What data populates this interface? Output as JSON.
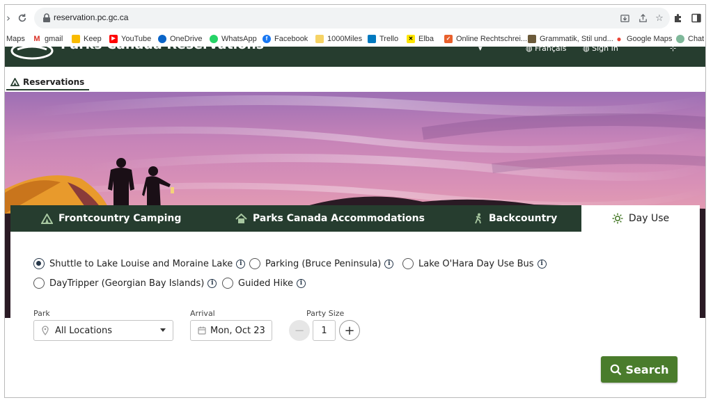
{
  "browser": {
    "url": "reservation.pc.gc.ca",
    "bookmarks": [
      {
        "label": "Maps",
        "icon": "maps-icon"
      },
      {
        "label": "gmail",
        "icon": "gmail-icon"
      },
      {
        "label": "Keep",
        "icon": "keep-icon"
      },
      {
        "label": "YouTube",
        "icon": "youtube-icon"
      },
      {
        "label": "OneDrive",
        "icon": "onedrive-icon"
      },
      {
        "label": "WhatsApp",
        "icon": "whatsapp-icon"
      },
      {
        "label": "Facebook",
        "icon": "facebook-icon"
      },
      {
        "label": "1000Miles",
        "icon": "folder-icon"
      },
      {
        "label": "Trello",
        "icon": "trello-icon"
      },
      {
        "label": "Elba",
        "icon": "elba-icon"
      },
      {
        "label": "Online Rechtschrei...",
        "icon": "check-icon"
      },
      {
        "label": "Grammatik, Stil und...",
        "icon": "grammar-icon"
      },
      {
        "label": "Google Maps",
        "icon": "google-maps-icon"
      },
      {
        "label": "Chat",
        "icon": "chat-icon"
      }
    ]
  },
  "site": {
    "title": "Parks Canada Reservations",
    "lang_link": "Français",
    "account_link": "Sign In"
  },
  "nav": {
    "reservations_label": "Reservations"
  },
  "tabs": [
    {
      "label": "Frontcountry Camping",
      "icon": "tent-icon"
    },
    {
      "label": "Parks Canada Accommodations",
      "icon": "house-icon"
    },
    {
      "label": "Backcountry",
      "icon": "hiker-icon"
    },
    {
      "label": "Day Use",
      "icon": "sun-icon",
      "active": true
    }
  ],
  "day_use_options": [
    {
      "label": "Shuttle to Lake Louise and Moraine Lake",
      "checked": true
    },
    {
      "label": "Parking (Bruce Peninsula)",
      "checked": false
    },
    {
      "label": "Lake O'Hara Day Use Bus",
      "checked": false
    },
    {
      "label": "DayTripper (Georgian Bay Islands)",
      "checked": false
    },
    {
      "label": "Guided Hike",
      "checked": false
    }
  ],
  "form": {
    "park_label": "Park",
    "park_value": "All Locations",
    "arrival_label": "Arrival",
    "arrival_value": "Mon, Oct 23",
    "party_label": "Party Size",
    "party_value": "1",
    "search_label": "Search"
  },
  "colors": {
    "header_green": "#263d2f",
    "button_green": "#4a7c2c",
    "radio_navy": "#26374a"
  }
}
